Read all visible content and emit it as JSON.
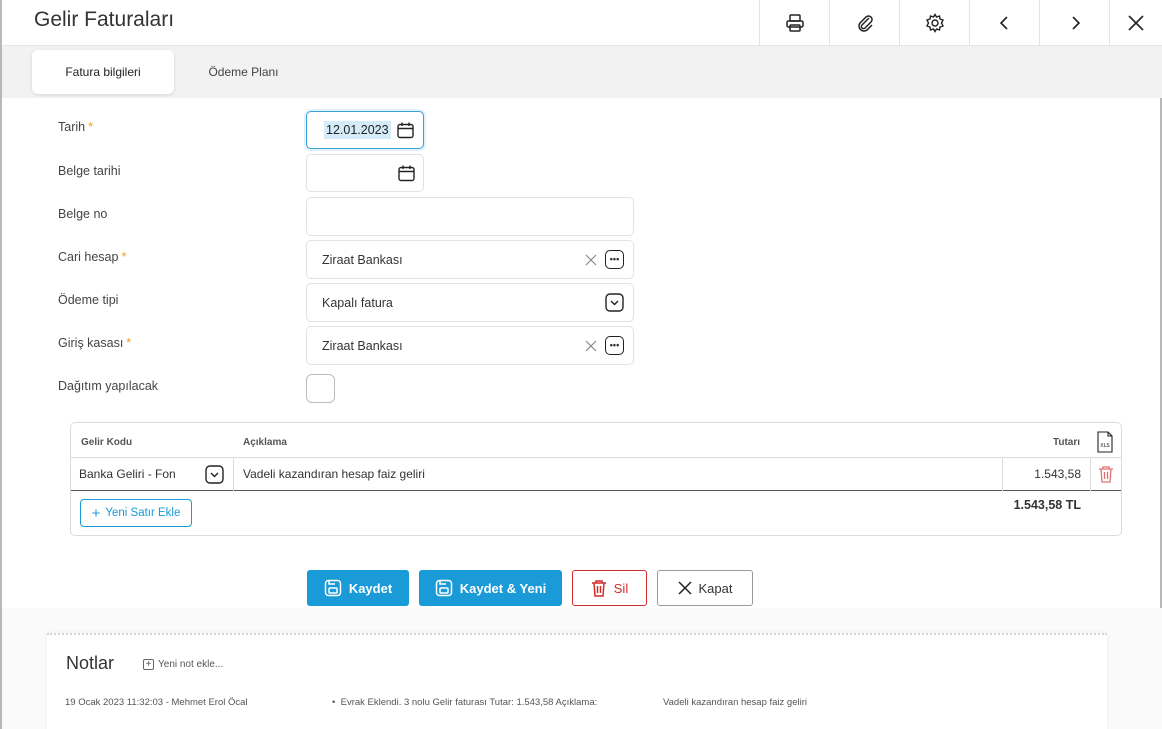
{
  "window": {
    "title": "Gelir Faturaları"
  },
  "toolbar": {
    "icons": [
      "printer-icon",
      "paperclip-icon",
      "gear-icon",
      "chevron-left-icon",
      "chevron-right-icon",
      "close-icon"
    ]
  },
  "tabs": [
    {
      "label": "Fatura bilgileri",
      "active": true
    },
    {
      "label": "Ödeme Planı",
      "active": false
    }
  ],
  "form": {
    "tarih_label": "Tarih",
    "tarih_value": "12.01.2023",
    "belge_tarihi_label": "Belge tarihi",
    "belge_tarihi_value": "",
    "belge_no_label": "Belge no",
    "belge_no_value": "",
    "cari_hesap_label": "Cari hesap",
    "cari_hesap_value": "Ziraat Bankası",
    "odeme_tipi_label": "Ödeme tipi",
    "odeme_tipi_value": "Kapalı fatura",
    "giris_kasasi_label": "Giriş kasası",
    "giris_kasasi_value": "Ziraat Bankası",
    "dagitim_label": "Dağıtım yapılacak",
    "dagitim_checked": false,
    "required_mark": "*"
  },
  "grid": {
    "headers": {
      "code": "Gelir Kodu",
      "desc": "Açıklama",
      "amount": "Tutarı"
    },
    "rows": [
      {
        "code": "Banka Geliri - Fon",
        "desc": "Vadeli kazandıran hesap faiz geliri",
        "amount": "1.543,58"
      }
    ],
    "add_row_label": "Yeni Satır Ekle",
    "total": "1.543,58 TL"
  },
  "actions": {
    "save": "Kaydet",
    "save_new": "Kaydet & Yeni",
    "delete": "Sil",
    "close": "Kapat"
  },
  "notes": {
    "title": "Notlar",
    "add_label": "Yeni not ekle...",
    "entries": [
      {
        "meta": "19 Ocak 2023 11:32:03 - Mehmet Erol Öcal",
        "text": "Evrak Eklendi. 3 nolu Gelir faturası Tutar: 1.543,58 Açıklama:",
        "detail": "Vadeli kazandıran hesap faiz geliri"
      }
    ]
  },
  "colors": {
    "primary": "#1a9ad6",
    "danger": "#d02c2c",
    "required": "#f0a020"
  }
}
